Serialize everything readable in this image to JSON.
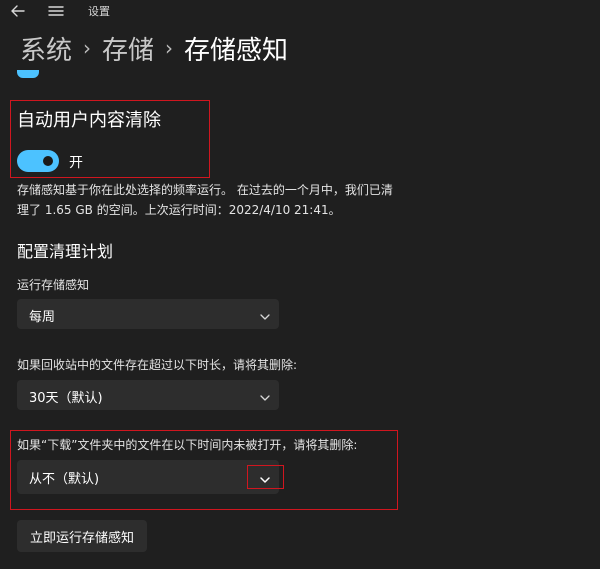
{
  "window": {
    "title": "设置"
  },
  "breadcrumb": {
    "items": [
      "系统",
      "存储",
      "存储感知"
    ],
    "separator": "›"
  },
  "auto_cleanup": {
    "title": "自动用户内容清除",
    "toggle_state": "开",
    "toggle_on": true,
    "description_line1": "存储感知基于你在此处选择的频率运行。 在过去的一个月中，我们已清",
    "description_line2": "理了 1.65 GB 的空间。上次运行时间：2022/4/10 21:41。"
  },
  "schedule": {
    "title": "配置清理计划",
    "run_label": "运行存储感知",
    "run_value": "每周",
    "recycle_label": "如果回收站中的文件存在超过以下时长，请将其删除:",
    "recycle_value": "30天（默认)",
    "downloads_label": "如果“下载”文件夹中的文件在以下时间内未被打开，请将其删除:",
    "downloads_value": "从不（默认)"
  },
  "actions": {
    "run_now_label": "立即运行存储感知"
  },
  "colors": {
    "background": "#1f1f1f",
    "accent": "#4cc2ff",
    "control": "#2d2d2d",
    "highlight_box": "#d0161f"
  }
}
